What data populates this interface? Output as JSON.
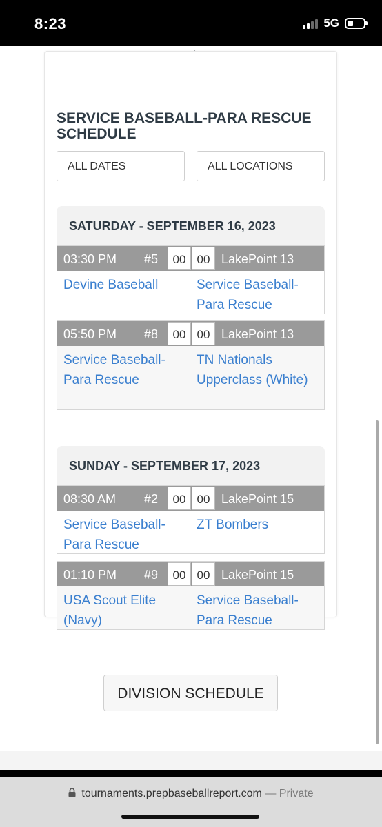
{
  "status": {
    "time": "8:23",
    "network": "5G"
  },
  "schedule": {
    "title": "SERVICE BASEBALL-PARA RESCUE SCHEDULE",
    "filters": {
      "dates": "ALL DATES",
      "locations": "ALL LOCATIONS"
    },
    "days": [
      {
        "label": "SATURDAY - SEPTEMBER 16, 2023",
        "games": [
          {
            "time": "03:30 PM",
            "number": "#5",
            "score1": "00",
            "score2": "00",
            "location": "LakePoint 13",
            "team1": "Devine Baseball",
            "team2": "Service Baseball-Para Rescue"
          },
          {
            "time": "05:50 PM",
            "number": "#8",
            "score1": "00",
            "score2": "00",
            "location": "LakePoint 13",
            "team1": "Service Baseball-Para Rescue",
            "team2": "TN Nationals Upperclass (White)"
          }
        ]
      },
      {
        "label": "SUNDAY - SEPTEMBER 17, 2023",
        "games": [
          {
            "time": "08:30 AM",
            "number": "#2",
            "score1": "00",
            "score2": "00",
            "location": "LakePoint 15",
            "team1": "Service Baseball-Para Rescue",
            "team2": "ZT Bombers"
          },
          {
            "time": "01:10 PM",
            "number": "#9",
            "score1": "00",
            "score2": "00",
            "location": "LakePoint 15",
            "team1": "USA Scout Elite (Navy)",
            "team2": "Service Baseball-Para Rescue"
          }
        ]
      }
    ],
    "division_button": "DIVISION SCHEDULE"
  },
  "browser": {
    "url": "tournaments.prepbaseballreport.com",
    "private_label": "— Private"
  },
  "icons": {
    "refresh": "refresh-icon",
    "lock": "lock-icon",
    "battery": "battery-icon",
    "signal": "signal-icon"
  },
  "colors": {
    "link": "#3a7fcf",
    "game_bar": "#9a9a9a",
    "title": "#2f3b45"
  }
}
